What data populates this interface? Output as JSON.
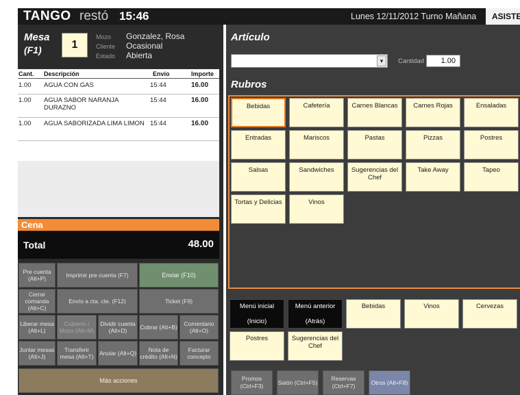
{
  "header": {
    "logo": "TANGO",
    "logo_sub": "restó",
    "time": "15:46",
    "date_shift": "Lunes 12/11/2012 Turno Mañana",
    "asistencia": "ASISTENCI"
  },
  "mesa": {
    "label": "Mesa",
    "key": "(F1)",
    "number": "1",
    "mozo_label": "Mozo",
    "mozo": "Gonzalez, Rosa",
    "cliente_label": "Cliente",
    "cliente": "Ocasional",
    "estado_label": "Estado",
    "estado": "Abierta"
  },
  "order": {
    "headers": {
      "qty": "Cant.",
      "desc": "Descripción",
      "envio": "Envío",
      "importe": "Importe"
    },
    "rows": [
      {
        "qty": "1.00",
        "desc": "AGUA CON GAS",
        "envio": "15:44",
        "importe": "16.00"
      },
      {
        "qty": "1.00",
        "desc": "AGUA SABOR NARANJA DURAZNO",
        "envio": "15:44",
        "importe": "16.00"
      },
      {
        "qty": "1.00",
        "desc": "AGUA SABORIZADA LIMA LIMON",
        "envio": "15:44",
        "importe": "16.00"
      }
    ]
  },
  "service": "Cena",
  "total": {
    "label": "Total",
    "value": "48.00"
  },
  "actions": {
    "pre_cuenta": "Pre cuenta (Alt+P)",
    "imprimir_pre_cuenta": "Imprimir pre cuenta (F7)",
    "enviar": "Enviar (F10)",
    "cerrar_comanda": "Cerrar comanda (Alt+C)",
    "envio_cta": "Envío a cta. cte. (F12)",
    "ticket": "Ticket (F9)",
    "liberar_mesa": "Liberar mesa (Alt+L)",
    "cubierto_mozo": "Cubierto / Mozo (Alt+M)",
    "dividir_cuenta": "Dividir cuenta (Alt+D)",
    "cobrar": "Cobrar (Alt+B)",
    "comentario": "Comentario (Alt+O)",
    "juntar_mesas": "Juntar mesas (Alt+J)",
    "transferir_mesa": "Transferir mesa (Alt+T)",
    "anular": "Anular (Alt+Q)",
    "nota_credito": "Nota de crédito (Alt+N)",
    "facturar_concepto": "Facturar concepto",
    "mas_acciones": "Más acciones"
  },
  "articulo": {
    "title": "Artículo",
    "select_value": "",
    "cantidad_label": "Cantidad",
    "cantidad_value": "1.00"
  },
  "rubros": {
    "title": "Rubros",
    "selected": "Bebidas",
    "items": [
      "Bebidas",
      "Cafetería",
      "Carnes Blancas",
      "Carnes Rojas",
      "Ensaladas",
      "Entradas",
      "Mariscos",
      "Pastas",
      "Pizzas",
      "Postres",
      "Salsas",
      "Sandwiches",
      "Sugerencias del Chef",
      "Take Away",
      "Tapeo",
      "Tortas y Delicias",
      "Vinos"
    ]
  },
  "nav": {
    "menu_inicial": "Menú inicial",
    "menu_inicial_key": "(Inicio)",
    "menu_anterior": "Menú anterior",
    "menu_anterior_key": "(Atrás)",
    "items": [
      "Bebidas",
      "Vinos",
      "Cervezas",
      "Postres",
      "Sugerencias del Chef"
    ]
  },
  "bottom": {
    "promos": "Promos (Ctrl+F3)",
    "salon": "Salón (Ctrl+F5)",
    "reservas": "Reservas (Ctrl+F7)",
    "otros": "Otros (Alt+F8)"
  },
  "colors": {
    "accent_orange": "#f28c36",
    "tile_yellow": "#fff9d4",
    "enviar_green": "#6f8f6f",
    "mas_acciones_brown": "#8d7b5d",
    "otros_blue": "#7b86a8"
  }
}
